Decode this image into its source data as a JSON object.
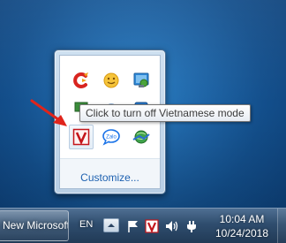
{
  "tooltip": {
    "text": "Click to turn off Vietnamese mode"
  },
  "tray_popup": {
    "customize_label": "Customize...",
    "icons": [
      {
        "name": "ccleaner-icon"
      },
      {
        "name": "yellow-smiley-icon"
      },
      {
        "name": "display-settings-icon"
      },
      {
        "name": "hidden-icon-1"
      },
      {
        "name": "hidden-icon-2"
      },
      {
        "name": "hidden-icon-3"
      },
      {
        "name": "unikey-v-icon"
      },
      {
        "name": "zalo-icon"
      },
      {
        "name": "network-globe-icon"
      }
    ]
  },
  "taskbar": {
    "task_button_label": "New Microsoft",
    "language": "EN",
    "clock": {
      "time": "10:04 AM",
      "date": "10/24/2018"
    }
  },
  "colors": {
    "arrow": "#e0241b",
    "link": "#1e61b0",
    "unikey_v": "#c4161c"
  }
}
